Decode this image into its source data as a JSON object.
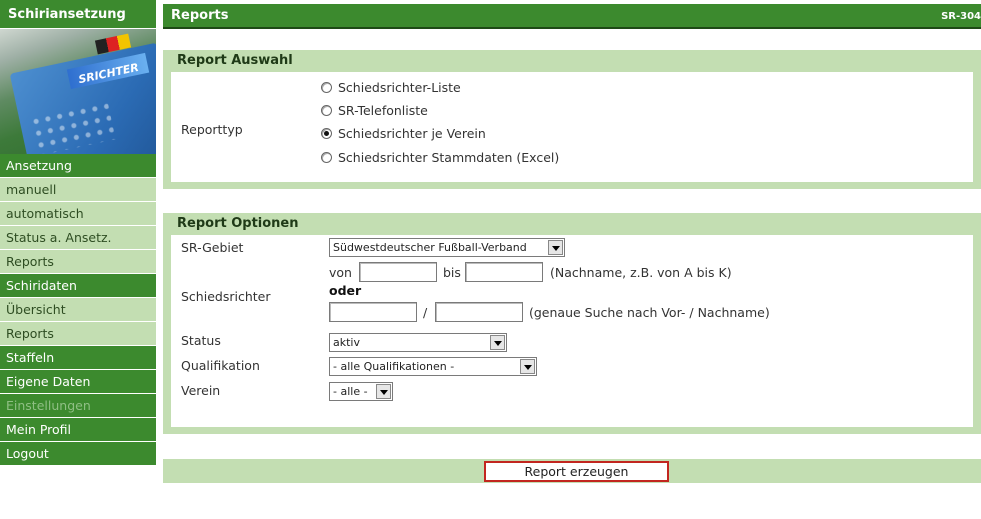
{
  "sidebar": {
    "title": "Schiriansetzung",
    "image_text": "SRICHTER",
    "items": [
      {
        "label": "Ansetzung",
        "kind": "head"
      },
      {
        "label": "manuell",
        "kind": "sub"
      },
      {
        "label": "automatisch",
        "kind": "sub"
      },
      {
        "label": "Status a. Ansetz.",
        "kind": "sub"
      },
      {
        "label": "Reports",
        "kind": "sub"
      },
      {
        "label": "Schiridaten",
        "kind": "head"
      },
      {
        "label": "Übersicht",
        "kind": "sub"
      },
      {
        "label": "Reports",
        "kind": "sub"
      },
      {
        "label": "Staffeln",
        "kind": "head"
      },
      {
        "label": "Eigene Daten",
        "kind": "head"
      },
      {
        "label": "Einstellungen",
        "kind": "disabled"
      },
      {
        "label": "Mein Profil",
        "kind": "head"
      },
      {
        "label": "Logout",
        "kind": "head"
      }
    ]
  },
  "header": {
    "title": "Reports",
    "code": "SR-304"
  },
  "auswahl": {
    "title": "Report Auswahl",
    "label": "Reporttyp",
    "options": [
      {
        "label": "Schiedsrichter-Liste",
        "checked": false
      },
      {
        "label": "SR-Telefonliste",
        "checked": false
      },
      {
        "label": "Schiedsrichter je Verein",
        "checked": true
      },
      {
        "label": "Schiedsrichter Stammdaten (Excel)",
        "checked": false
      }
    ]
  },
  "optionen": {
    "title": "Report Optionen",
    "sr_gebiet": {
      "label": "SR-Gebiet",
      "value": "Südwestdeutscher Fußball-Verband"
    },
    "schiedsrichter": {
      "label": "Schiedsrichter",
      "von": "von",
      "bis": "bis",
      "range_hint": "(Nachname, z.B. von A bis K)",
      "oder": "oder",
      "slash": "/",
      "exact_hint": "(genaue Suche nach Vor- / Nachname)",
      "von_value": "",
      "bis_value": "",
      "vorname_value": "",
      "nachname_value": ""
    },
    "status": {
      "label": "Status",
      "value": "aktiv"
    },
    "qualifikation": {
      "label": "Qualifikation",
      "value": "- alle Qualifikationen -"
    },
    "verein": {
      "label": "Verein",
      "value": "- alle -"
    }
  },
  "action": {
    "button": "Report erzeugen"
  },
  "colors": {
    "primary_green": "#3c8a2e",
    "light_green": "#c3deb2",
    "button_border": "#c2261f"
  }
}
